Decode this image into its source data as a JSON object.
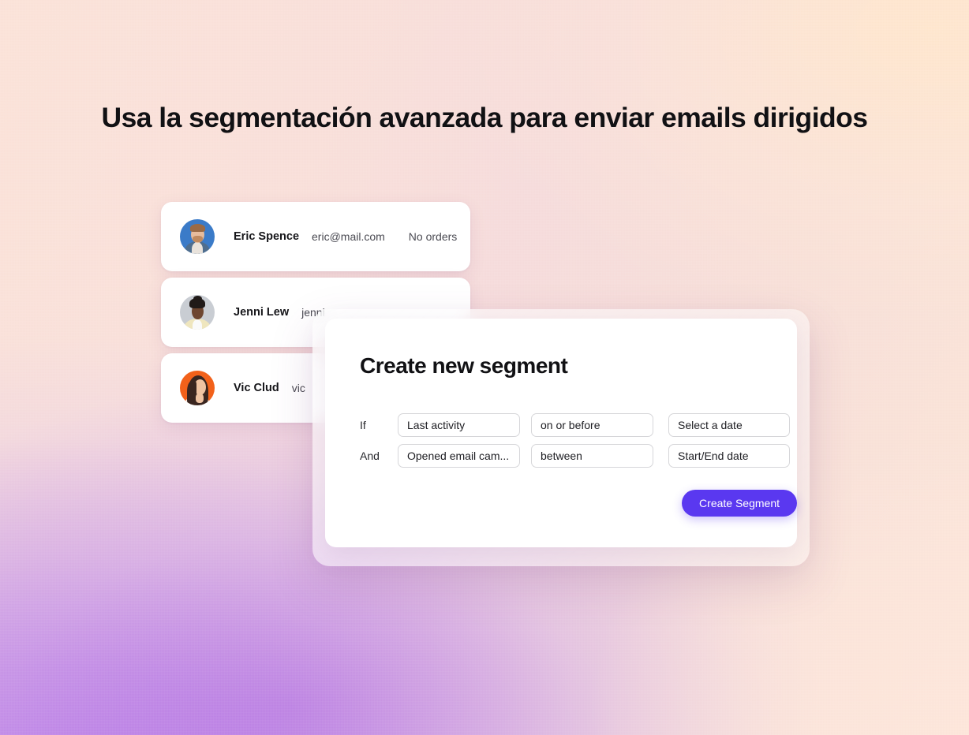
{
  "headline": "Usa la segmentación avanzada para enviar emails dirigidos",
  "colors": {
    "accent": "#5A38F0",
    "headline_text": "#111114",
    "card_bg": "#FFFFFF",
    "field_border": "#D6D6D9",
    "bg_peach": "#FBE3D9",
    "bg_purple": "#B778E9"
  },
  "contacts": {
    "rows": [
      {
        "avatar_name": "avatar-eric-spence",
        "avatar_bg": "#3B7BC8",
        "name": "Eric Spence",
        "email": "eric@mail.com",
        "orders": "No orders"
      },
      {
        "avatar_name": "avatar-jenni-lew",
        "avatar_bg": "#C9CDD3",
        "name": "Jenni Lew",
        "email": "jenni",
        "orders": ""
      },
      {
        "avatar_name": "avatar-vic-clud",
        "avatar_bg": "#F2611A",
        "name": "Vic Clud",
        "email": "vic",
        "orders": ""
      }
    ]
  },
  "modal": {
    "title": "Create new segment",
    "rules": [
      {
        "conjunction": "If",
        "attribute": "Last activity",
        "operator": "on or before",
        "value": "Select a date"
      },
      {
        "conjunction": "And",
        "attribute": "Opened email cam...",
        "operator": "between",
        "value": "Start/End date"
      }
    ],
    "submit_label": "Create Segment"
  }
}
